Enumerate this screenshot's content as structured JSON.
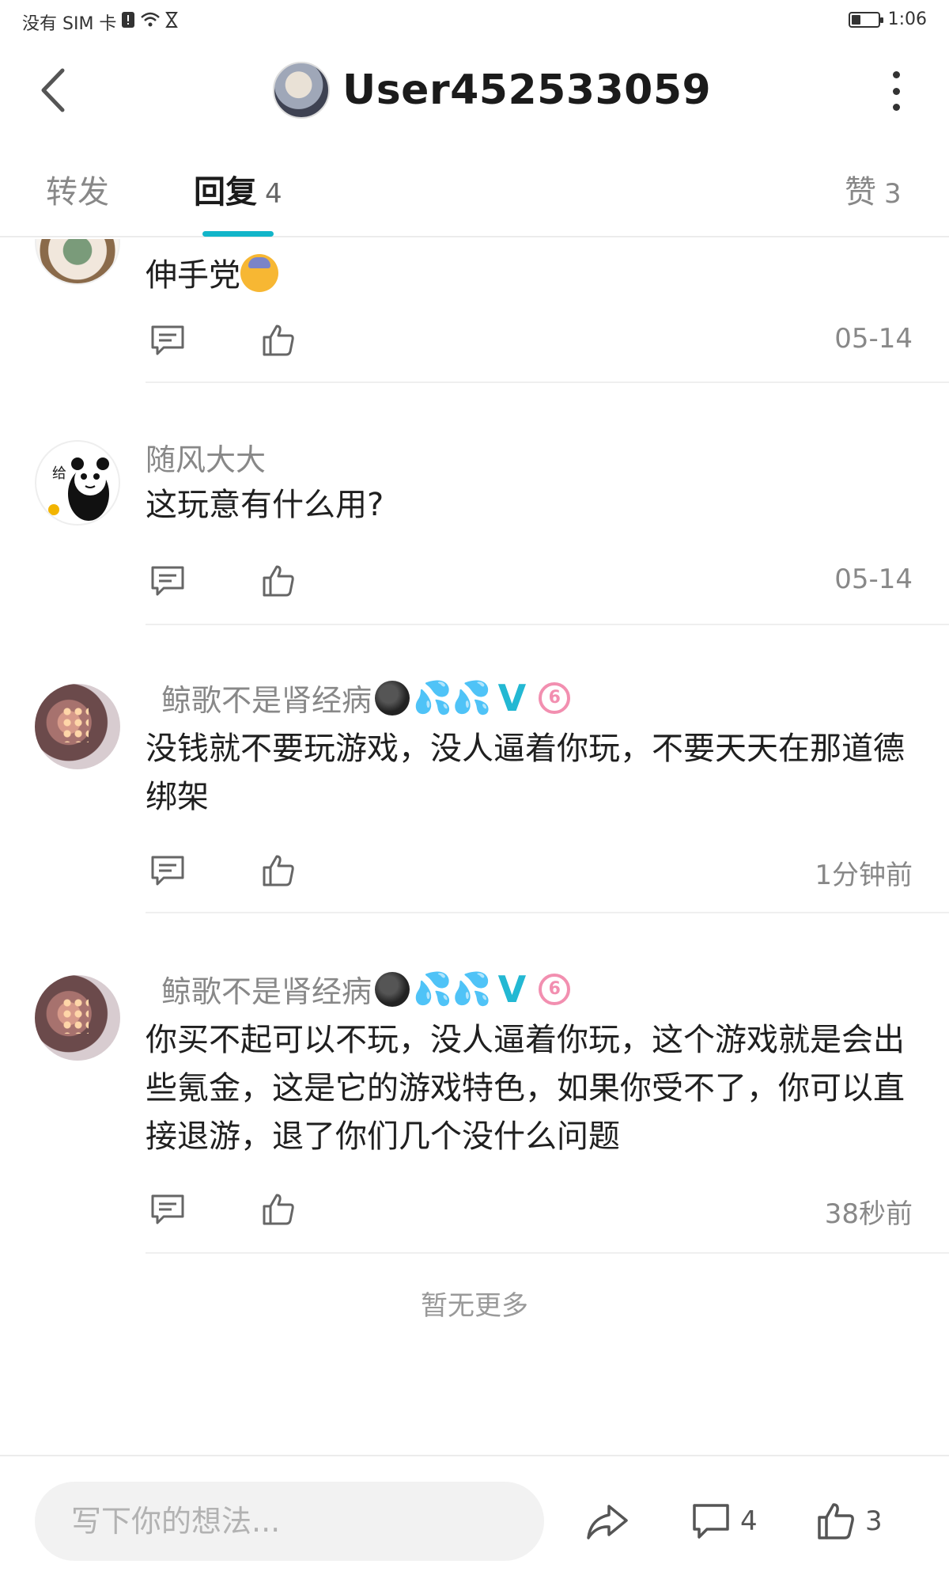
{
  "status_bar": {
    "left_text": "没有 SIM 卡",
    "time": "1:06",
    "battery_level": 0.35
  },
  "header": {
    "title": "User452533059",
    "back_icon": "chevron-left-icon",
    "more_icon": "more-vertical-icon"
  },
  "tabs": [
    {
      "label": "转发",
      "count": ""
    },
    {
      "label": "回复",
      "count": "4"
    },
    {
      "label": "赞",
      "count": "3"
    }
  ],
  "comments": [
    {
      "username": "",
      "text": "伸手党",
      "time": "05-14"
    },
    {
      "username": "随风大大",
      "avatar_text": "给",
      "text": "这玩意有什么用?",
      "time": "05-14"
    },
    {
      "username": "鲸歌不是肾经病",
      "badge_drops": "💦💦",
      "badge_v": "V",
      "badge_level": "6",
      "text": "没钱就不要玩游戏，没人逼着你玩，不要天天在那道德绑架",
      "time": "1分钟前"
    },
    {
      "username": "鲸歌不是肾经病",
      "badge_drops": "💦💦",
      "badge_v": "V",
      "badge_level": "6",
      "text": "你买不起可以不玩，没人逼着你玩，这个游戏就是会出些氪金，这是它的游戏特色，如果你受不了，你可以直接退游，退了你们几个没什么问题",
      "time": "38秒前"
    }
  ],
  "no_more": "暂无更多",
  "bottom_bar": {
    "input_placeholder": "写下你的想法...",
    "comment_count": "4",
    "like_count": "3"
  },
  "colors": {
    "accent": "#12b5c9",
    "badge_v": "#23b8d3",
    "badge_level": "#f28fb0"
  }
}
